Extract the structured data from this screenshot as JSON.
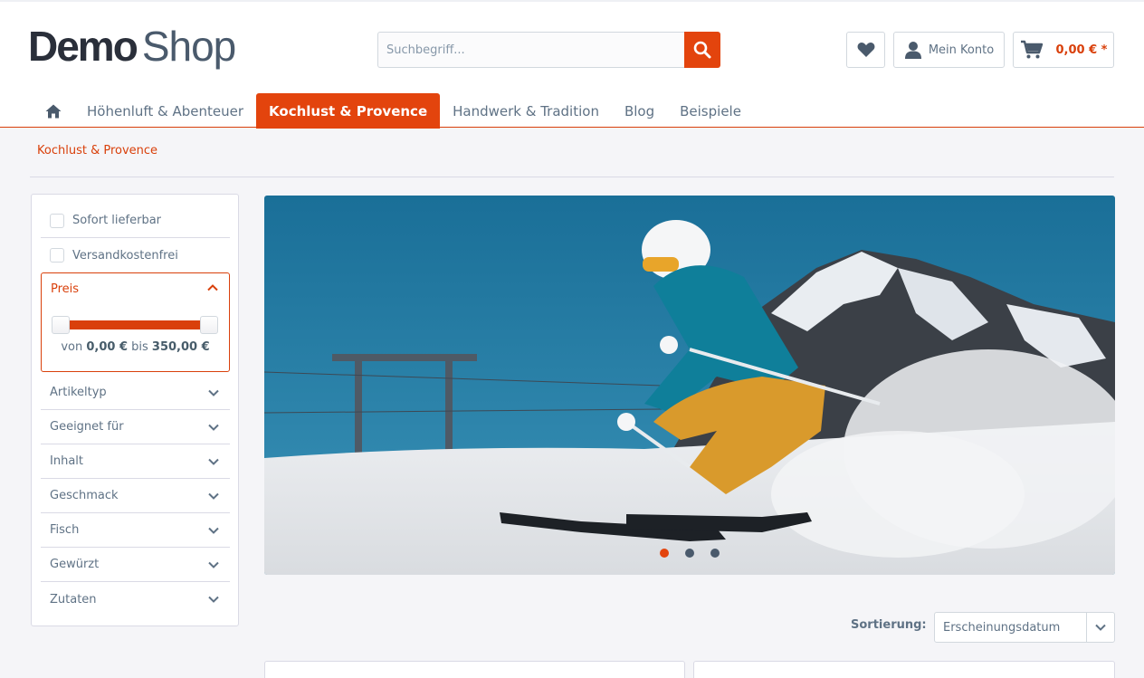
{
  "logo": {
    "part1": "Demo",
    "part2": "Shop"
  },
  "search": {
    "placeholder": "Suchbegriff...",
    "button_icon": "search-icon"
  },
  "header": {
    "wishlist_icon": "heart-icon",
    "account_label": "Mein Konto",
    "cart_amount": "0,00 € *"
  },
  "nav": {
    "home_icon": "home-icon",
    "items": [
      {
        "label": "Höhenluft & Abenteuer"
      },
      {
        "label": "Kochlust & Provence"
      },
      {
        "label": "Handwerk & Tradition"
      },
      {
        "label": "Blog"
      },
      {
        "label": "Beispiele"
      }
    ]
  },
  "breadcrumb": "Kochlust & Provence",
  "filters": {
    "checkboxes": [
      {
        "label": "Sofort lieferbar"
      },
      {
        "label": "Versandkostenfrei"
      }
    ],
    "price": {
      "title": "Preis",
      "from_prefix": "von",
      "min": "0,00 €",
      "to_word": "bis",
      "max": "350,00 €"
    },
    "facets": [
      {
        "label": "Artikeltyp"
      },
      {
        "label": "Geeignet für"
      },
      {
        "label": "Inhalt"
      },
      {
        "label": "Geschmack"
      },
      {
        "label": "Fisch"
      },
      {
        "label": "Gewürzt"
      },
      {
        "label": "Zutaten"
      }
    ]
  },
  "banner": {
    "slides": 3,
    "active_slide": 1
  },
  "sort": {
    "label": "Sortierung:",
    "value": "Erscheinungsdatum"
  },
  "colors": {
    "accent": "#e3440d",
    "text": "#5f7285"
  }
}
